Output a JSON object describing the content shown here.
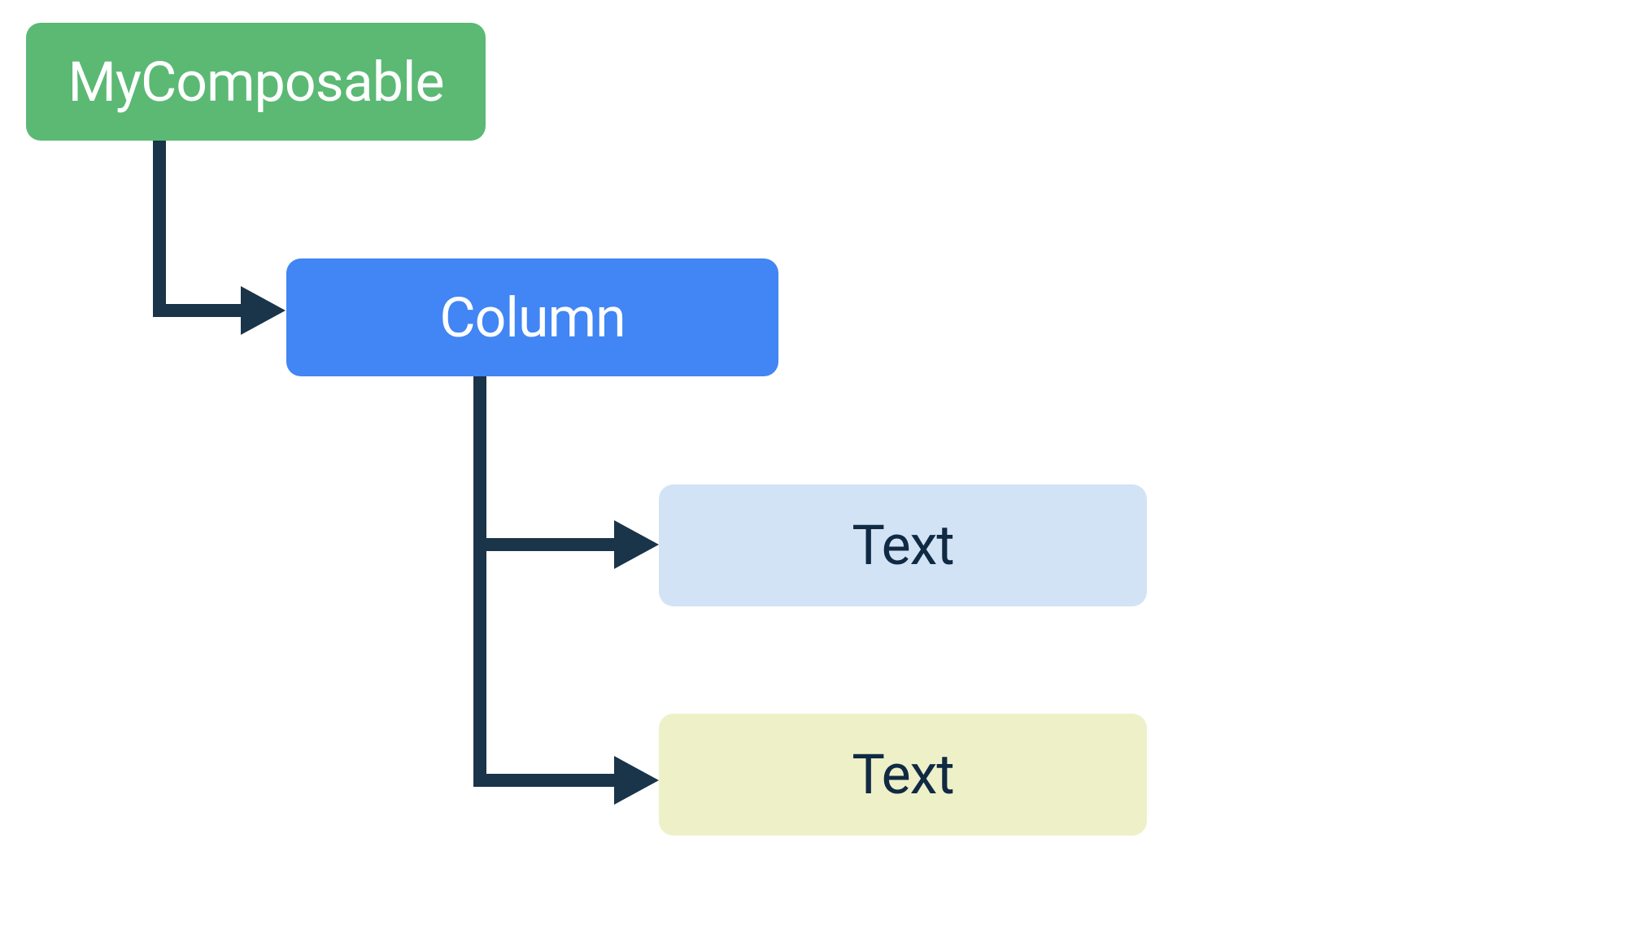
{
  "diagram": {
    "nodes": {
      "root": {
        "label": "MyComposable",
        "color": "#5bb974",
        "text_color": "#ffffff"
      },
      "column": {
        "label": "Column",
        "color": "#4285f4",
        "text_color": "#ffffff"
      },
      "text1": {
        "label": "Text",
        "color": "#d2e3f5",
        "text_color": "#102a43"
      },
      "text2": {
        "label": "Text",
        "color": "#eef0c8",
        "text_color": "#102a43"
      }
    },
    "edges": [
      {
        "from": "root",
        "to": "column"
      },
      {
        "from": "column",
        "to": "text1"
      },
      {
        "from": "column",
        "to": "text2"
      }
    ]
  }
}
